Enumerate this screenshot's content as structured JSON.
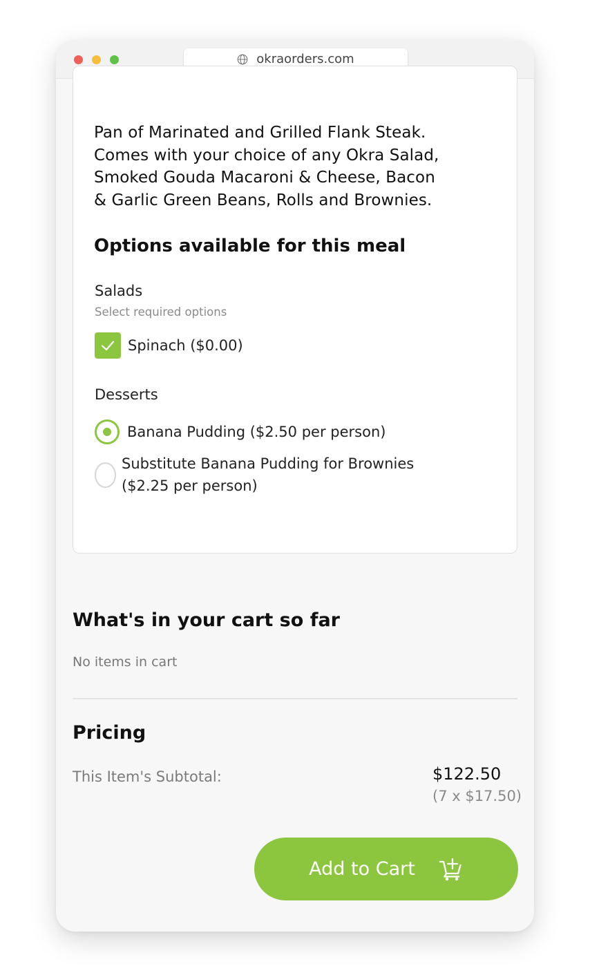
{
  "browser": {
    "url": "okraorders.com"
  },
  "meal": {
    "description_lines": [
      "Pan of Marinated and Grilled Flank Steak.",
      "Comes with your choice of any Okra Salad,",
      "Smoked Gouda Macaroni & Cheese, Bacon",
      "& Garlic Green Beans, Rolls and Brownies."
    ],
    "options_title": "Options available for this meal",
    "salads": {
      "label": "Salads",
      "hint": "Select required options",
      "options": [
        {
          "label": "Spinach ($0.00)",
          "checked": true
        }
      ]
    },
    "desserts": {
      "label": "Desserts",
      "options": [
        {
          "label": "Banana Pudding ($2.50 per person)",
          "selected": true
        },
        {
          "label_line1": "Substitute Banana Pudding for Brownies",
          "label_line2": "($2.25 per person)",
          "selected": false
        }
      ]
    }
  },
  "cart": {
    "title": "What's in your cart so far",
    "empty_text": "No items in cart"
  },
  "pricing": {
    "title": "Pricing",
    "subtotal_label": "This Item's Subtotal:",
    "subtotal_value": "$122.50",
    "subtotal_calc": "(7 x $17.50)"
  },
  "actions": {
    "add_to_cart_label": "Add to Cart"
  },
  "colors": {
    "accent": "#8cc63f"
  }
}
